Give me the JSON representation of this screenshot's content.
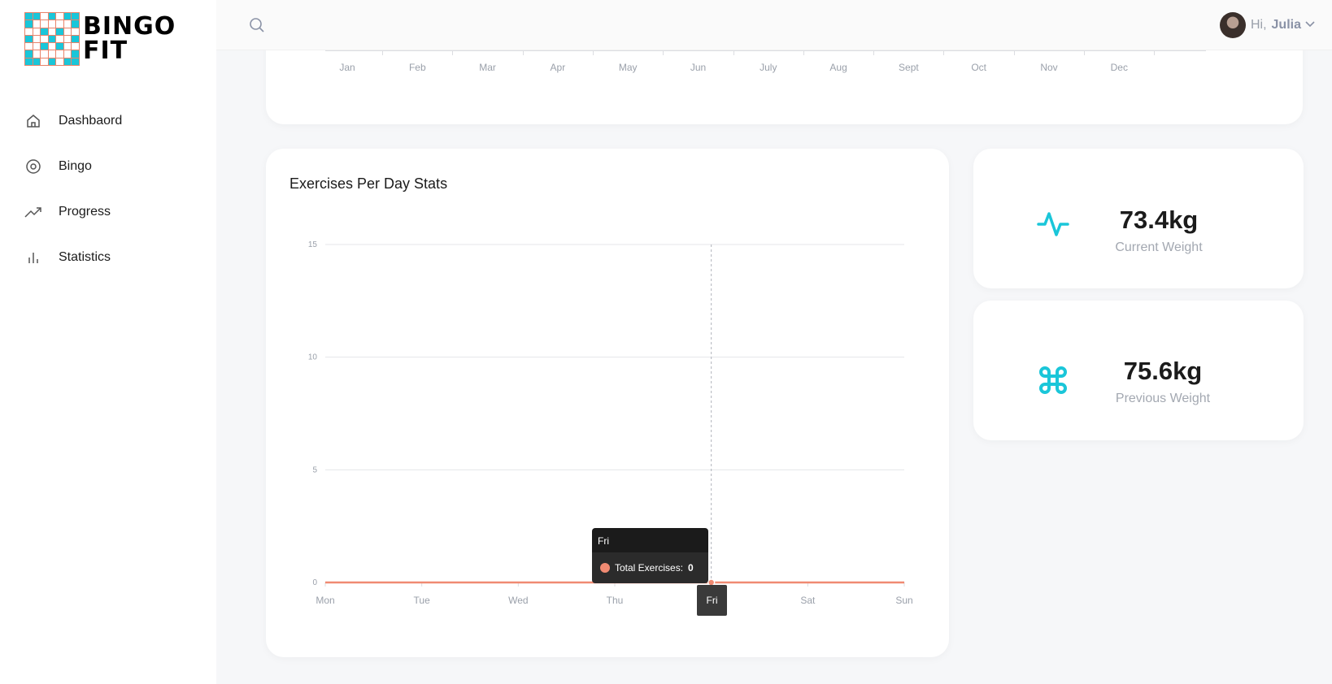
{
  "brand": {
    "logo_line1": "BINGO",
    "logo_line2": "FIT"
  },
  "sidebar": {
    "items": [
      {
        "label": "Dashbaord",
        "icon": "home-icon"
      },
      {
        "label": "Bingo",
        "icon": "target-icon"
      },
      {
        "label": "Progress",
        "icon": "trending-up-icon"
      },
      {
        "label": "Statistics",
        "icon": "bar-chart-icon"
      }
    ]
  },
  "topbar": {
    "greeting": "Hi,",
    "username": "Julia"
  },
  "monthly_axis": {
    "months": [
      "Jan",
      "Feb",
      "Mar",
      "Apr",
      "May",
      "Jun",
      "July",
      "Aug",
      "Sept",
      "Oct",
      "Nov",
      "Dec"
    ]
  },
  "chart_data": {
    "type": "line",
    "title": "Exercises Per Day Stats",
    "categories": [
      "Mon",
      "Tue",
      "Wed",
      "Thu",
      "Fri",
      "Sat",
      "Sun"
    ],
    "series": [
      {
        "name": "Total Exercises",
        "values": [
          0,
          0,
          0,
          0,
          0,
          0,
          0
        ],
        "color": "#f08a72"
      }
    ],
    "yticks": [
      0,
      5,
      10,
      15
    ],
    "ylim": [
      0,
      15
    ],
    "grid": true,
    "tooltip": {
      "category": "Fri",
      "label": "Total Exercises:",
      "value": "0"
    },
    "hover_category": "Fri"
  },
  "stats": {
    "current": {
      "value": "73.4kg",
      "label": "Current Weight",
      "icon": "pulse-icon"
    },
    "previous": {
      "value": "75.6kg",
      "label": "Previous Weight",
      "icon": "command-icon"
    }
  },
  "colors": {
    "accent": "#1ac6d9",
    "line": "#f08a72",
    "logo_cyan": "#1ac6d9",
    "logo_salmon": "#e9836a"
  }
}
